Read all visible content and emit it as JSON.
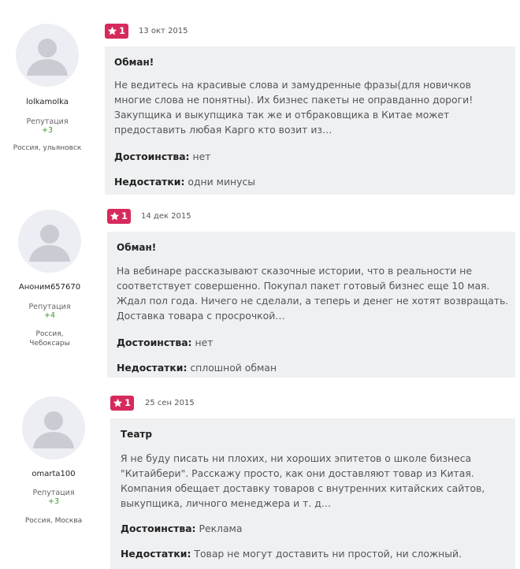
{
  "reviews": [
    {
      "user": {
        "name": "lolkamolka",
        "reputation_label": "Репутация",
        "reputation_value": "+3",
        "location": "Россия, ульяновск"
      },
      "rating": "1",
      "date": "13 окт 2015",
      "title": "Обман!",
      "text": "Не ведитесь на красивые слова и замудренные фразы(для новичков многие слова не понятны). Их бизнес пакеты не оправданно дороги! Закупщика и выкупщика так же и отбраковщика в Китае может предоставить любая Карго кто возит из…",
      "pros_label": "Достоинства:",
      "pros": "нет",
      "cons_label": "Недостатки:",
      "cons": "одни минусы"
    },
    {
      "user": {
        "name": "Аноним657670",
        "reputation_label": "Репутация",
        "reputation_value": "+4",
        "location_line1": "Россия,",
        "location_line2": "Чебоксары"
      },
      "rating": "1",
      "date": "14 дек 2015",
      "title": "Обман!",
      "text": "На вебинаре рассказывают сказочные истории, что в реальности не соответствует совершенно. Покупал пакет готовый бизнес еще 10 мая. Ждал пол года. Ничего не сделали, а теперь и денег не хотят возвращать. Доставка товара с просрочкой…",
      "pros_label": "Достоинства:",
      "pros": "нет",
      "cons_label": "Недостатки:",
      "cons": "сплошной обман"
    },
    {
      "user": {
        "name": "omarta100",
        "reputation_label": "Репутация",
        "reputation_value": "+3",
        "location": "Россия, Москва"
      },
      "rating": "1",
      "date": "25 сен 2015",
      "title": "Театр",
      "text": "Я не буду писать ни плохих, ни хороших эпитетов о школе бизнеса \"Китайбери\". Расскажу просто, как они доставляют товар из Китая. Компания обещает доставку товаров с внутренних китайских сайтов, выкупщика, личного менеджера и т. д…",
      "pros_label": "Достоинства:",
      "pros": "Реклама",
      "cons_label": "Недостатки:",
      "cons": "Товар не могут доставить ни простой, ни сложный."
    }
  ],
  "colors": {
    "badge": "#d72a5c",
    "card_bg": "#eff0f2",
    "reputation": "#3a9a2c"
  },
  "icons": {
    "rating": "star-icon",
    "avatar": "user-silhouette-icon"
  }
}
